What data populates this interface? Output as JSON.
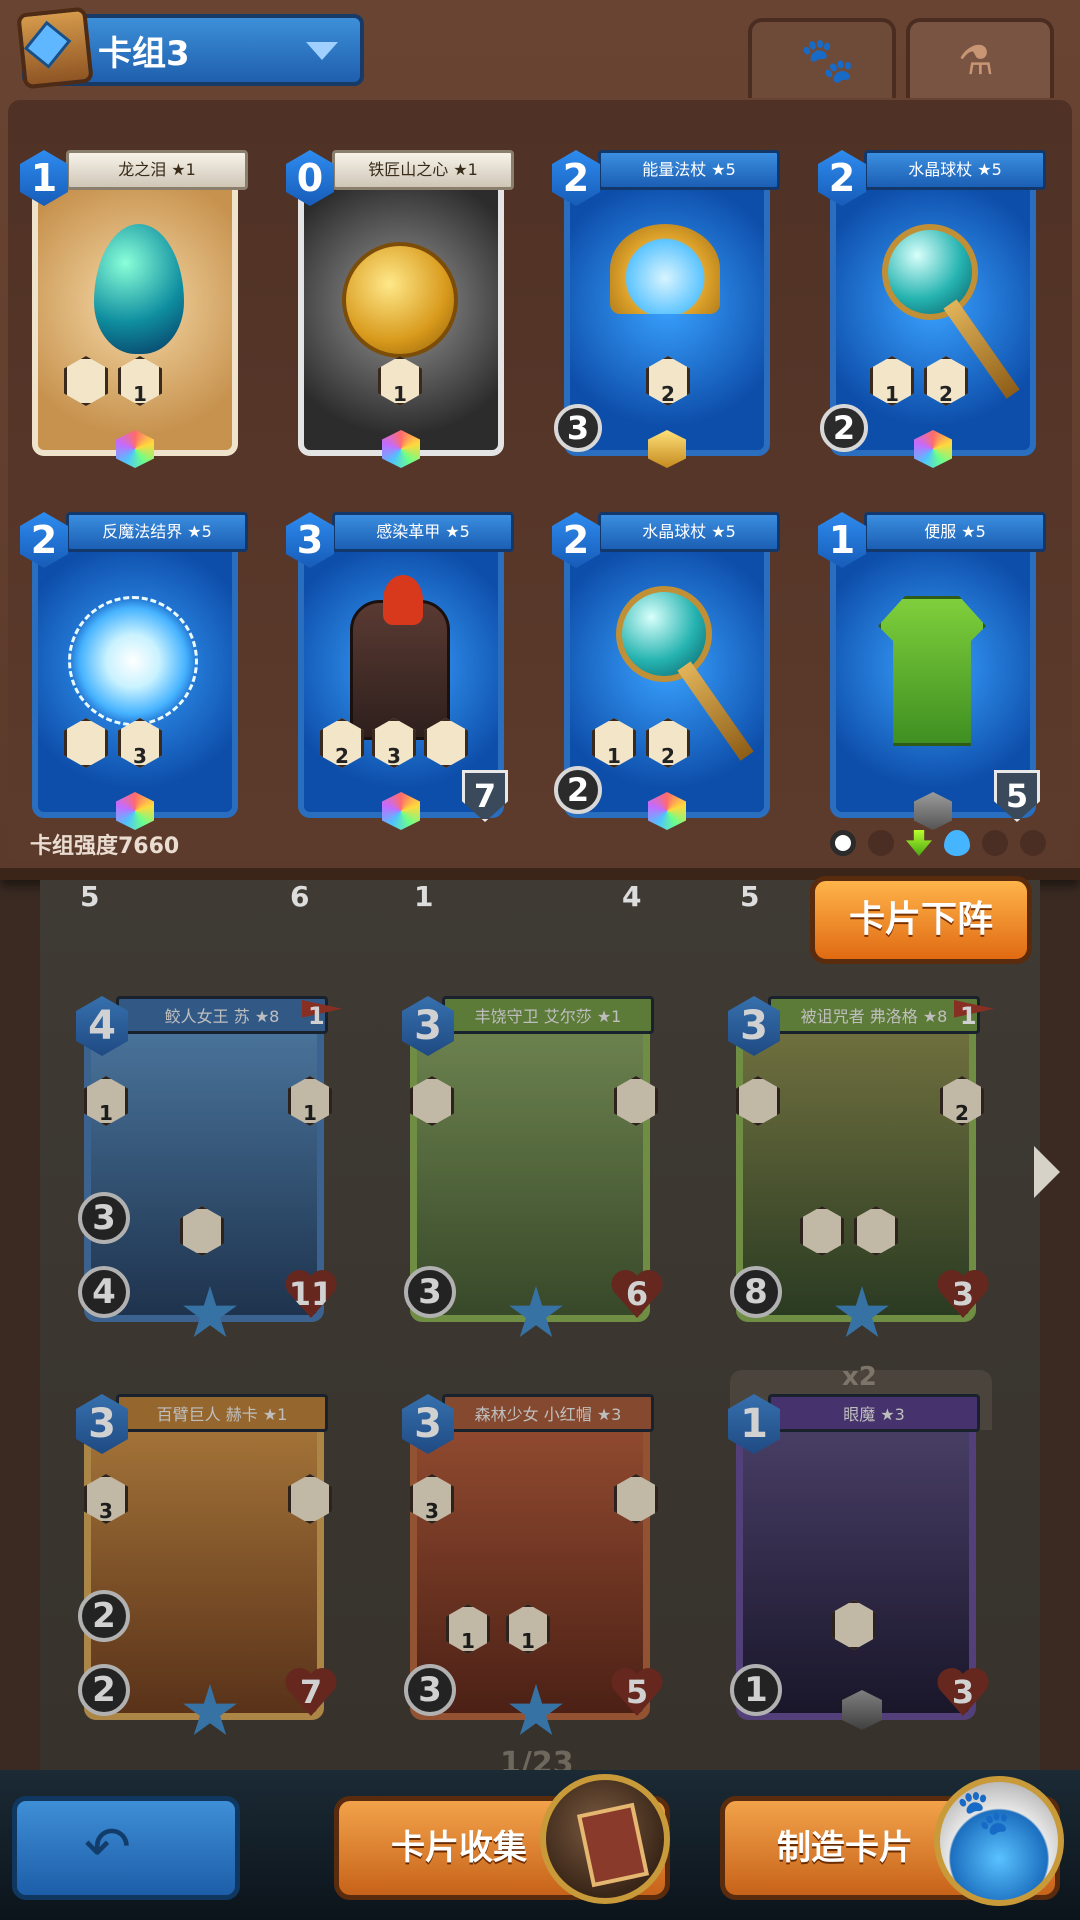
{
  "deck": {
    "title": "卡组3",
    "strength_label": "卡组强度7660",
    "tabs": [
      {
        "name": "pet",
        "icon": "paw-icon"
      },
      {
        "name": "potion",
        "icon": "potion-flask-icon"
      }
    ],
    "filters": [
      "neutral-icon",
      "beast-icon",
      "nature-icon",
      "water-icon",
      "mechanical-icon",
      "fire-icon"
    ],
    "cards": [
      {
        "cost": "1",
        "name": "龙之泪 ★1",
        "skills": [
          "",
          "1"
        ]
      },
      {
        "cost": "0",
        "name": "铁匠山之心 ★1",
        "skills": [
          "1"
        ]
      },
      {
        "cost": "2",
        "name": "能量法杖 ★5",
        "skills": [
          "2"
        ],
        "attack": "3"
      },
      {
        "cost": "2",
        "name": "水晶球杖 ★5",
        "skills": [
          "1",
          "2"
        ],
        "attack": "2"
      },
      {
        "cost": "2",
        "name": "反魔法结界 ★5",
        "skills": [
          "",
          "3"
        ]
      },
      {
        "cost": "3",
        "name": "感染革甲 ★5",
        "skills": [
          "2",
          "3",
          ""
        ],
        "armor": "7"
      },
      {
        "cost": "2",
        "name": "水晶球杖 ★5",
        "skills": [
          "1",
          "2"
        ],
        "attack": "2"
      },
      {
        "cost": "1",
        "name": "便服 ★5",
        "armor": "5"
      }
    ]
  },
  "actions": {
    "remove_card": "卡片下阵",
    "collect": "卡片收集",
    "craft": "制造卡片"
  },
  "collection": {
    "partial_top_row": [
      "5",
      "6",
      "1",
      "4",
      "5"
    ],
    "cards": [
      {
        "cost": "4",
        "name": "鲛人女王 苏 ★8",
        "flag": "1",
        "skills": [
          "1",
          "1",
          ""
        ],
        "extra": "3",
        "attack": "4",
        "hp": "11"
      },
      {
        "cost": "3",
        "name": "丰饶守卫 艾尔莎 ★1",
        "skills": [
          "",
          ""
        ],
        "attack": "3",
        "hp": "6"
      },
      {
        "cost": "3",
        "name": "被诅咒者 弗洛格 ★8",
        "flag": "1",
        "skills": [
          "",
          "2",
          "",
          ""
        ],
        "attack": "8",
        "hp": "3"
      },
      {
        "cost": "3",
        "name": "百臂巨人 赫卡 ★1",
        "skills": [
          "3",
          ""
        ],
        "extra": "2",
        "attack": "2",
        "hp": "7"
      },
      {
        "cost": "3",
        "name": "森林少女 小红帽 ★3",
        "skills": [
          "3",
          "",
          "1",
          "1"
        ],
        "attack": "3",
        "hp": "5"
      },
      {
        "cost": "1",
        "name": "眼魔 ★3",
        "copies": "x2",
        "skills": [
          ""
        ],
        "attack": "1",
        "hp": "3"
      }
    ],
    "page": "1/23"
  }
}
